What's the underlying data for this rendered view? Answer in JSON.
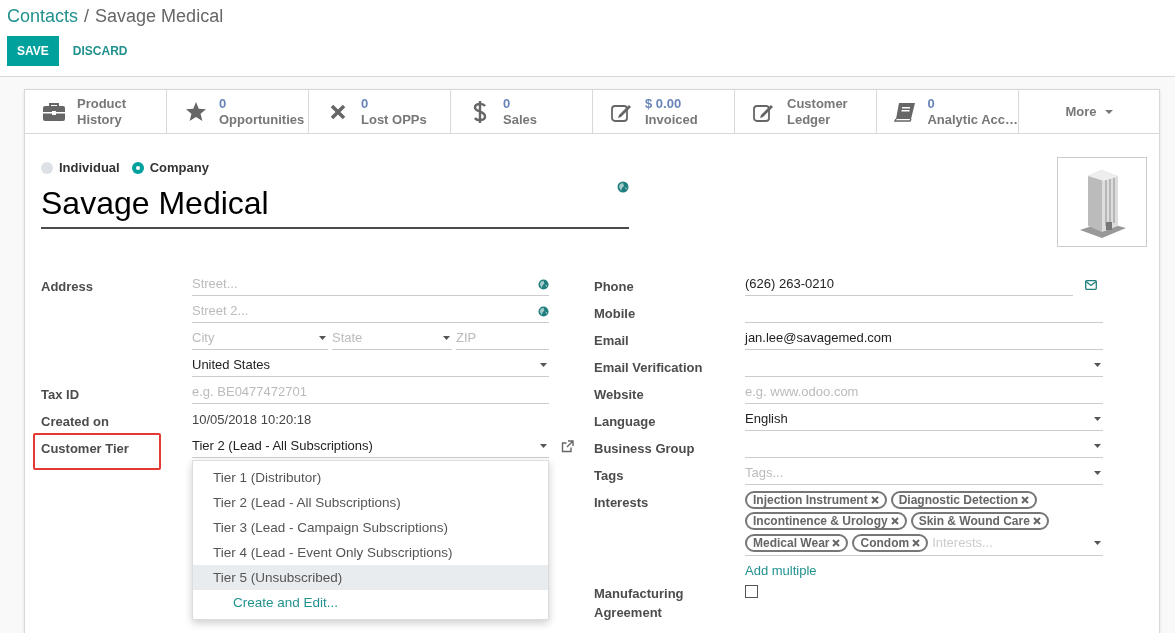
{
  "breadcrumb": {
    "parent": "Contacts",
    "separator": "/",
    "current": "Savage Medical"
  },
  "actions": [
    {
      "label": "SAVE",
      "kind": "primary"
    },
    {
      "label": "DISCARD",
      "kind": "link"
    }
  ],
  "smart_buttons": [
    {
      "kind": "link",
      "label": "Product History"
    },
    {
      "kind": "stat",
      "value": "0",
      "label": "Opportunities"
    },
    {
      "kind": "stat",
      "value": "0",
      "label": "Lost OPPs"
    },
    {
      "kind": "stat",
      "value": "0",
      "label": "Sales"
    },
    {
      "kind": "stat",
      "value": "$ 0.00",
      "label": "Invoiced"
    },
    {
      "kind": "link",
      "label": "Customer Ledger"
    },
    {
      "kind": "stat",
      "value": "0",
      "label": "Analytic Acc…"
    }
  ],
  "more": {
    "label": "More"
  },
  "company_type": [
    {
      "label": "Individual",
      "selected": false
    },
    {
      "label": "Company",
      "selected": true
    }
  ],
  "name": "Savage Medical",
  "address": {
    "label": "Address",
    "street": {
      "placeholder": "Street..."
    },
    "street2": {
      "placeholder": "Street 2..."
    },
    "city": {
      "placeholder": "City"
    },
    "state": {
      "placeholder": "State"
    },
    "zip": {
      "placeholder": "ZIP"
    },
    "country": {
      "value": "United States"
    }
  },
  "left_fields": [
    {
      "label": "Tax ID",
      "kind": "input",
      "placeholder": "e.g. BE0477472701"
    },
    {
      "label": "Created on",
      "kind": "text",
      "value": "10/05/2018 10:20:18"
    },
    {
      "label": "Customer Tier",
      "kind": "select",
      "value": "Tier 2 (Lead - All Subscriptions)",
      "highlighted": true,
      "external_link": true,
      "expanded": true,
      "options": [
        {
          "label": "Tier 1 (Distributor)",
          "highlighted": false
        },
        {
          "label": "Tier 2 (Lead - All Subscriptions)",
          "highlighted": false
        },
        {
          "label": "Tier 3 (Lead - Campaign Subscriptions)",
          "highlighted": false
        },
        {
          "label": "Tier 4 (Lead - Event Only Subscriptions)",
          "highlighted": false
        },
        {
          "label": "Tier 5 (Unsubscribed)",
          "highlighted": true
        }
      ],
      "create_label": "Create and Edit..."
    }
  ],
  "right_fields": [
    {
      "label": "Phone",
      "kind": "input",
      "value": "(626) 263-0210",
      "send_button": true
    },
    {
      "label": "Mobile",
      "kind": "input"
    },
    {
      "label": "Email",
      "kind": "input",
      "value": "jan.lee@savagemed.com"
    },
    {
      "label": "Email Verification",
      "kind": "select"
    },
    {
      "label": "Website",
      "kind": "input",
      "placeholder": "e.g. www.odoo.com"
    },
    {
      "label": "Language",
      "kind": "select",
      "value": "English"
    },
    {
      "label": "Business Group",
      "kind": "select"
    },
    {
      "label": "Tags",
      "kind": "select",
      "placeholder": "Tags..."
    },
    {
      "label": "Interests",
      "kind": "tags",
      "tags": [
        "Injection Instrument",
        "Diagnostic Detection",
        "Incontinence & Urology",
        "Skin & Wound Care",
        "Medical Wear",
        "Condom"
      ],
      "placeholder": "Interests...",
      "link": "Add multiple"
    },
    {
      "label": "Manufacturing Agreement",
      "kind": "checkbox",
      "checked": false
    }
  ]
}
